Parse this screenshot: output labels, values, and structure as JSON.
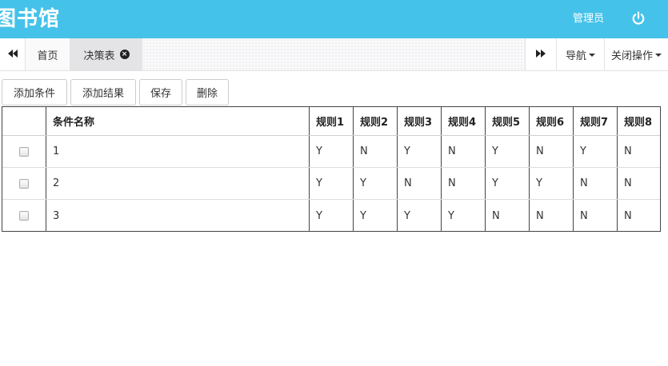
{
  "header": {
    "brand": "图书馆",
    "admin": "管理员",
    "power_icon": "power-icon",
    "background": "#45c2e9"
  },
  "tabbar": {
    "left_icon": "backward-icon",
    "home_tab": "首页",
    "active_tab": "决策表",
    "close_icon": "close-circle-icon",
    "right_icon": "forward-icon",
    "nav_menu": "导航",
    "close_ops_menu": "关闭操作"
  },
  "toolbar": {
    "add_condition": "添加条件",
    "add_result": "添加结果",
    "save": "保存",
    "delete": "删除"
  },
  "table": {
    "columns": [
      "条件名称",
      "规则1",
      "规则2",
      "规则3",
      "规则4",
      "规则5",
      "规则6",
      "规则7",
      "规则8"
    ],
    "rows": [
      {
        "name": "1",
        "values": [
          "Y",
          "N",
          "Y",
          "N",
          "Y",
          "N",
          "Y",
          "N"
        ]
      },
      {
        "name": "2",
        "values": [
          "Y",
          "Y",
          "N",
          "N",
          "Y",
          "Y",
          "N",
          "N"
        ]
      },
      {
        "name": "3",
        "values": [
          "Y",
          "Y",
          "Y",
          "Y",
          "N",
          "N",
          "N",
          "N"
        ]
      }
    ]
  }
}
